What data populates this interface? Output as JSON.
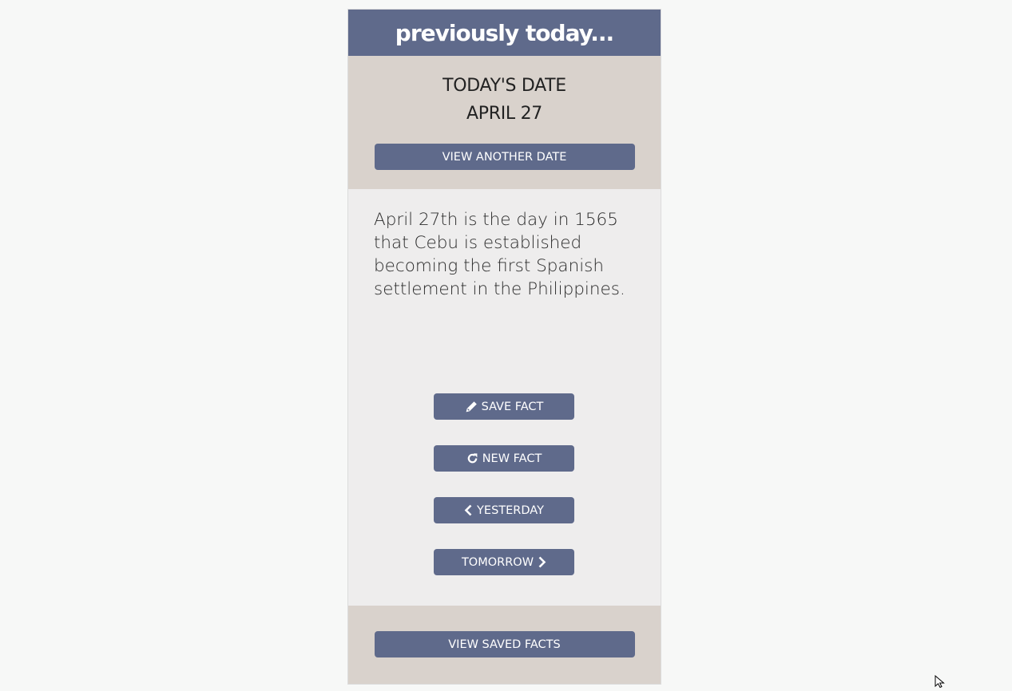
{
  "header": {
    "title": "previously today..."
  },
  "date_panel": {
    "label": "TODAY'S DATE",
    "date": "APRIL 27",
    "view_another_label": "VIEW ANOTHER DATE"
  },
  "fact": {
    "text": "April 27th is the day in 1565 that Cebu is established becoming the first Spanish settlement in the Philippines."
  },
  "actions": {
    "save_label": "SAVE FACT",
    "new_label": "NEW FACT",
    "yesterday_label": "YESTERDAY",
    "tomorrow_label": "TOMORROW"
  },
  "footer": {
    "view_saved_label": "VIEW SAVED FACTS"
  },
  "icons": {
    "save": "pencil-icon",
    "new": "refresh-icon",
    "yesterday": "chevron-left-icon",
    "tomorrow": "chevron-right-icon"
  },
  "colors": {
    "accent": "#5f6a8b",
    "panel": "#d9d2cc",
    "content": "#eeeded",
    "background": "#f7f8f7"
  }
}
